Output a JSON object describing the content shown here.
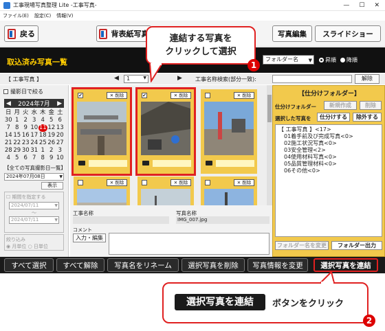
{
  "window": {
    "title": "工事現場写真整理 Lite -工事写真-",
    "minimize": "—",
    "maximize": "☐",
    "close": "✕"
  },
  "menu": [
    "ファイル(E)",
    "設定(C)",
    "情報(V)"
  ],
  "toolbar": {
    "back": "戻る",
    "cover": "背表紙写真",
    "edit": "写真編集",
    "slideshow": "スライドショー"
  },
  "header": {
    "title": "取込済み写真一覧",
    "folder_select": "フォルダー名",
    "sort_asc": "昇順",
    "sort_desc": "降順"
  },
  "subbar": {
    "label": "【 工事写真 】",
    "page": "1",
    "search_label": "工事名称検索(部分一致):",
    "search_value": "",
    "clear": "解除"
  },
  "left": {
    "date_filter": "撮影日で絞る",
    "cal_title": "2024年7月",
    "weekdays": [
      "日",
      "月",
      "火",
      "水",
      "木",
      "金",
      "土"
    ],
    "days": [
      "30",
      "1",
      "2",
      "3",
      "4",
      "5",
      "6",
      "7",
      "8",
      "9",
      "10",
      "11",
      "12",
      "13",
      "14",
      "15",
      "16",
      "17",
      "18",
      "19",
      "20",
      "21",
      "22",
      "23",
      "24",
      "25",
      "26",
      "27",
      "28",
      "29",
      "30",
      "31",
      "1",
      "2",
      "3",
      "4",
      "5",
      "6",
      "7",
      "8",
      "9",
      "10"
    ],
    "today_index": 11,
    "list_label": "【全ての写真撮影日一覧】",
    "list_value": "2024年07月08日",
    "show": "表示",
    "period_label": "期間を指定する",
    "period_from": "2024/07/11",
    "period_sep": "〜",
    "period_to": "2024/07/11",
    "narrow_label": "絞り込み",
    "unit_month": "月単位",
    "unit_day": "日単位"
  },
  "cards": [
    {
      "checked": "✔",
      "delete": "✕ 削除"
    },
    {
      "checked": "✔",
      "delete": "✕ 削除"
    },
    {
      "checked": "",
      "delete": "✕ 削除"
    },
    {
      "checked": "",
      "delete": "✕ 削除"
    },
    {
      "checked": "",
      "delete": "✕ 削除"
    },
    {
      "checked": "",
      "delete": "✕ 削除"
    }
  ],
  "info": {
    "construction_name_label": "工事名称",
    "photo_name_label": "写真名称",
    "photo_name": "IMG_007.jpg",
    "comment_label": "コメント",
    "input_edit": "入力・編集"
  },
  "right": {
    "title": "【仕分けフォルダー】",
    "sort_folder": "仕分けフォルダー",
    "new": "新規作成",
    "delete": "削除",
    "selected_label": "選択した写真を",
    "sort_btn": "仕分けする",
    "exclude_btn": "除外する",
    "tree": [
      "【 工事写真 】<17>",
      "01着手前及び完成写真<0>",
      "02施工状況写真<0>",
      "03安全管理<2>",
      "04使用材料写真<0>",
      "05品質管理材料<0>",
      "06その他<0>"
    ],
    "rename_btn": "フォルダー名を変更",
    "output_btn": "フォルダー出力"
  },
  "bottom": {
    "select_all": "すべて選択",
    "deselect_all": "すべて解除",
    "rename": "写真名をリネーム",
    "delete_selected": "選択写真を削除",
    "change_info": "写真情報を変更",
    "concat": "選択写真を連結"
  },
  "annotations": {
    "callout1_line1": "連結する写真を",
    "callout1_line2": "クリックして選択",
    "badge1": "1",
    "callout2_button": "選択写真を連結",
    "callout2_text": "ボタンをクリック",
    "badge2": "2"
  },
  "colors": {
    "accent_yellow": "#f2c94c",
    "highlight_red": "#e02020",
    "dark": "#111111"
  }
}
